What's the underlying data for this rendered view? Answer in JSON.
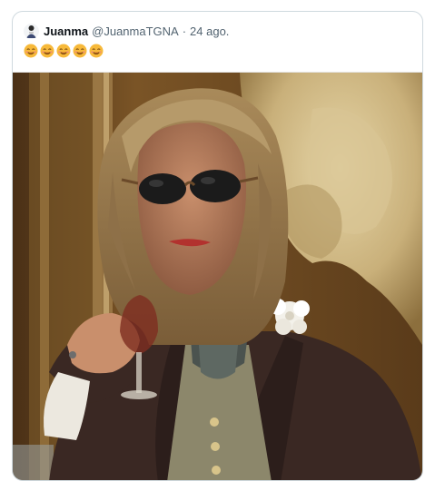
{
  "tweet": {
    "author_name": "Juanma",
    "author_handle": "@JuanmaTGNA",
    "separator": "·",
    "date": "24 ago.",
    "emojis": [
      {
        "icon": "smiling-face-with-smiling-eyes-icon",
        "char": "😊"
      },
      {
        "icon": "smiling-face-with-smiling-eyes-icon",
        "char": "😊"
      },
      {
        "icon": "smiling-face-with-smiling-eyes-icon",
        "char": "😊"
      },
      {
        "icon": "smiling-face-with-smiling-eyes-icon",
        "char": "😊"
      },
      {
        "icon": "smiling-face-with-smiling-eyes-icon",
        "char": "😊"
      }
    ],
    "media": {
      "icon": "meme-photo-toasting-man-sunglasses"
    }
  },
  "colors": {
    "name": "#0f1419",
    "secondary": "#536471",
    "border": "#cfd9de",
    "emoji_face": "#f7b93a"
  }
}
